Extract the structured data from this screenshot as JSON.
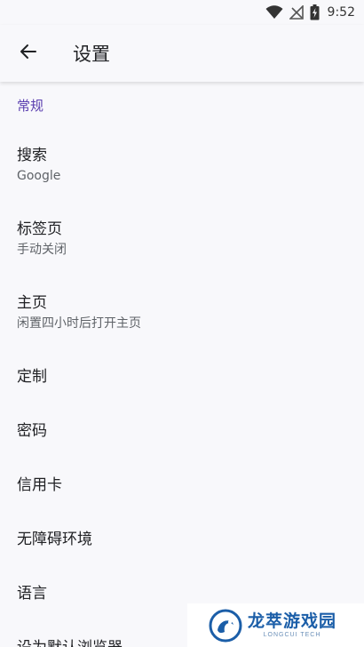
{
  "status_bar": {
    "time": "9:52",
    "icons": [
      "wifi-icon",
      "signal-off-icon",
      "battery-charging-icon"
    ]
  },
  "app_bar": {
    "back_icon": "arrow-left-icon",
    "title": "设置"
  },
  "sections": [
    {
      "header": "常规",
      "items": [
        {
          "title": "搜索",
          "summary": "Google"
        },
        {
          "title": "标签页",
          "summary": "手动关闭"
        },
        {
          "title": "主页",
          "summary": "闲置四小时后打开主页"
        },
        {
          "title": "定制"
        },
        {
          "title": "密码"
        },
        {
          "title": "信用卡"
        },
        {
          "title": "无障碍环境"
        },
        {
          "title": "语言"
        },
        {
          "title": "设为默认浏览器"
        }
      ]
    }
  ],
  "watermark": {
    "name": "龙萃游戏园",
    "sub": "LONGCUI TECH"
  },
  "colors": {
    "accent": "#5b3fb0",
    "background": "#f8f8fb",
    "watermark_blue": "#1b5ea8"
  }
}
